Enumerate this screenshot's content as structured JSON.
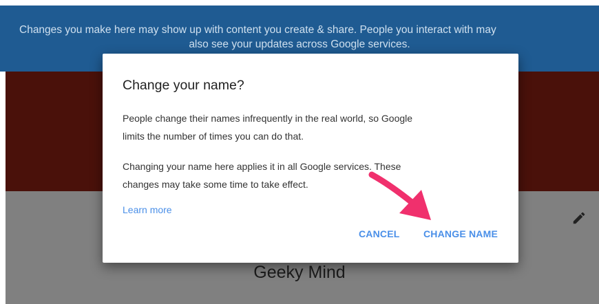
{
  "banner": {
    "line1": "Changes you make here may show up with content you create & share. People you interact with may",
    "line2": "also see your updates across Google services."
  },
  "profile": {
    "name": "Geeky Mind"
  },
  "dialog": {
    "title": "Change your name?",
    "paragraph1_line1": "People change their names infrequently in the real world, so Google",
    "paragraph1_line2": "limits the number of times you can do that.",
    "paragraph2_line1": "Changing your name here applies it in all Google services. These",
    "paragraph2_line2": "changes may take some time to take effect.",
    "learn_more": "Learn more",
    "cancel_label": "CANCEL",
    "change_label": "CHANGE NAME"
  },
  "icons": {
    "edit": "pencil-icon",
    "annotation": "arrow-annotation"
  },
  "colors": {
    "banner": "#1f5b92",
    "band": "#4a110a",
    "overlay_grey": "#808080",
    "link_blue": "#4a8fe8",
    "arrow_pink": "#f0306d"
  }
}
